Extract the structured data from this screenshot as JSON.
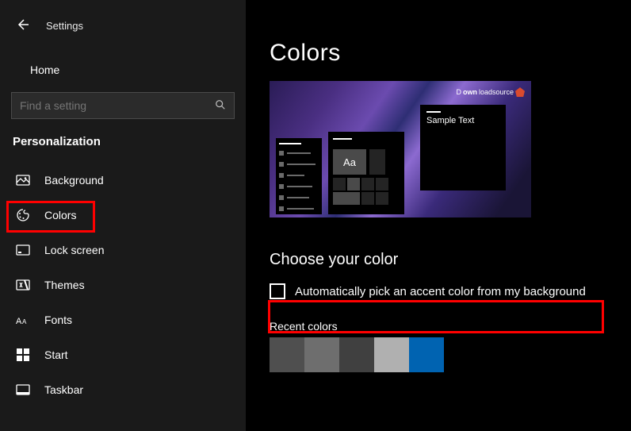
{
  "appTitle": "Settings",
  "home": "Home",
  "searchPlaceholder": "Find a setting",
  "category": "Personalization",
  "nav": {
    "background": "Background",
    "colors": "Colors",
    "lockscreen": "Lock screen",
    "themes": "Themes",
    "fonts": "Fonts",
    "start": "Start",
    "taskbar": "Taskbar"
  },
  "page": {
    "title": "Colors",
    "preview": {
      "watermarkPrefix": "D",
      "watermarkBold": "own",
      "watermarkRest": "loadsource",
      "sampleText": "Sample Text",
      "aa": "Aa"
    },
    "chooseTitle": "Choose your color",
    "autoPickLabel": "Automatically pick an accent color from my background",
    "autoPickChecked": false,
    "recentTitle": "Recent colors",
    "recentColors": [
      "#4f4f4f",
      "#6e6e6e",
      "#404040",
      "#b0b0b0",
      "#0063b1"
    ]
  }
}
